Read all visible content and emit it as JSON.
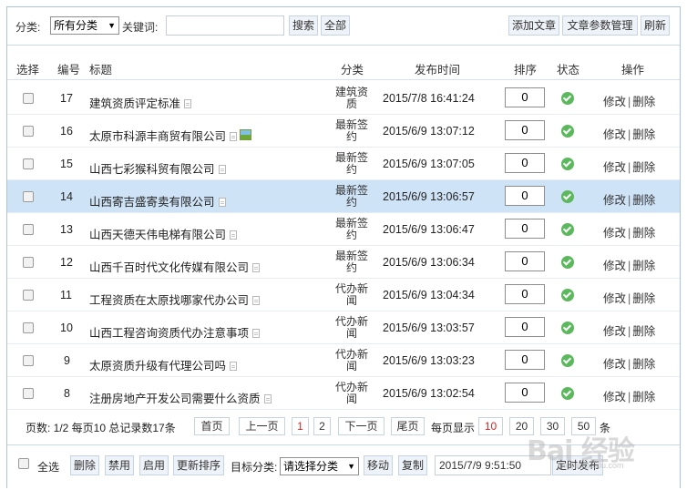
{
  "toolbar": {
    "category_label": "分类:",
    "category_value": "所有分类",
    "keyword_label": "关键词:",
    "keyword_value": "",
    "search_label": "搜索",
    "all_label": "全部",
    "add_label": "添加文章",
    "param_label": "文章参数管理",
    "refresh_label": "刷新"
  },
  "table": {
    "headers": {
      "select": "选择",
      "id": "编号",
      "title": "标题",
      "category": "分类",
      "time": "发布时间",
      "sort": "排序",
      "status": "状态",
      "actions": "操作"
    },
    "edit_label": "修改",
    "delete_label": "删除",
    "separator": "|",
    "rows": [
      {
        "id": "17",
        "title": "建筑资质评定标准",
        "category": "建筑资质",
        "time": "2015/7/8 16:41:24",
        "sort": "0",
        "image": false
      },
      {
        "id": "16",
        "title": "太原市科源丰商贸有限公司",
        "category": "最新签约",
        "time": "2015/6/9 13:07:12",
        "sort": "0",
        "image": true
      },
      {
        "id": "15",
        "title": "山西七彩猴科贸有限公司",
        "category": "最新签约",
        "time": "2015/6/9 13:07:05",
        "sort": "0",
        "image": false
      },
      {
        "id": "14",
        "title": "山西寄吉盛寄卖有限公司",
        "category": "最新签约",
        "time": "2015/6/9 13:06:57",
        "sort": "0",
        "image": false
      },
      {
        "id": "13",
        "title": "山西天德天伟电梯有限公司",
        "category": "最新签约",
        "time": "2015/6/9 13:06:47",
        "sort": "0",
        "image": false
      },
      {
        "id": "12",
        "title": "山西千百时代文化传媒有限公司",
        "category": "最新签约",
        "time": "2015/6/9 13:06:34",
        "sort": "0",
        "image": false
      },
      {
        "id": "11",
        "title": "工程资质在太原找哪家代办公司",
        "category": "代办新闻",
        "time": "2015/6/9 13:04:34",
        "sort": "0",
        "image": false
      },
      {
        "id": "10",
        "title": "山西工程咨询资质代办注意事项",
        "category": "代办新闻",
        "time": "2015/6/9 13:03:57",
        "sort": "0",
        "image": false
      },
      {
        "id": "9",
        "title": "太原资质升级有代理公司吗",
        "category": "代办新闻",
        "time": "2015/6/9 13:03:23",
        "sort": "0",
        "image": false
      },
      {
        "id": "8",
        "title": "注册房地产开发公司需要什么资质",
        "category": "代办新闻",
        "time": "2015/6/9 13:02:54",
        "sort": "0",
        "image": false
      }
    ]
  },
  "pager": {
    "summary": "页数: 1/2 每页10 总记录数17条",
    "first": "首页",
    "prev": "上一页",
    "page1": "1",
    "page2": "2",
    "next": "下一页",
    "last": "尾页",
    "per_page_label": "每页显示",
    "size10": "10",
    "size20": "20",
    "size30": "30",
    "size50": "50",
    "unit": "条"
  },
  "bottom": {
    "select_all": "全选",
    "delete": "删除",
    "disable": "禁用",
    "enable": "启用",
    "update_sort": "更新排序",
    "target_label": "目标分类:",
    "target_value": "请选择分类",
    "move": "移动",
    "copy": "复制",
    "datetime": "2015/7/9 9:51:50",
    "schedule": "定时发布"
  },
  "watermark": {
    "text": "Bai 经验",
    "sub": "jingyan.baidu.com"
  },
  "colors": {
    "highlight_row": "#cfe3f7",
    "status_ok": "#5cb85c",
    "active_page": "#e02020"
  }
}
